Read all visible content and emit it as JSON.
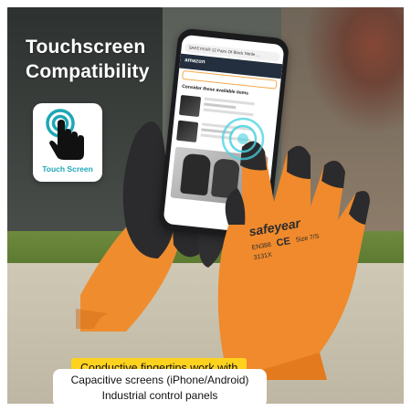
{
  "headline": {
    "line1": "Touchscreen",
    "line2": "Compatibility"
  },
  "touch_badge": {
    "icon": "touch-finger-icon",
    "label": "Touch Screen",
    "accent_color": "#1ea7b6"
  },
  "phone": {
    "url_text": "SAFEYEAR 12 Pairs Of Black Nitrile ...",
    "store_name": "amazon",
    "section_heading": "Consider these available items"
  },
  "glove": {
    "brand": "safeyear",
    "standard": "EN388",
    "code": "3131X",
    "ce_mark": "CE",
    "size_label": "Size 7/S",
    "shell_color": "#f08a2c",
    "coating_color": "#2b2b2d"
  },
  "caption": {
    "highlight": "Conductive fingertips work with",
    "line1": "Capacitive screens (iPhone/Android)",
    "line2": "Industrial control panels",
    "highlight_color": "#ffd21e"
  }
}
